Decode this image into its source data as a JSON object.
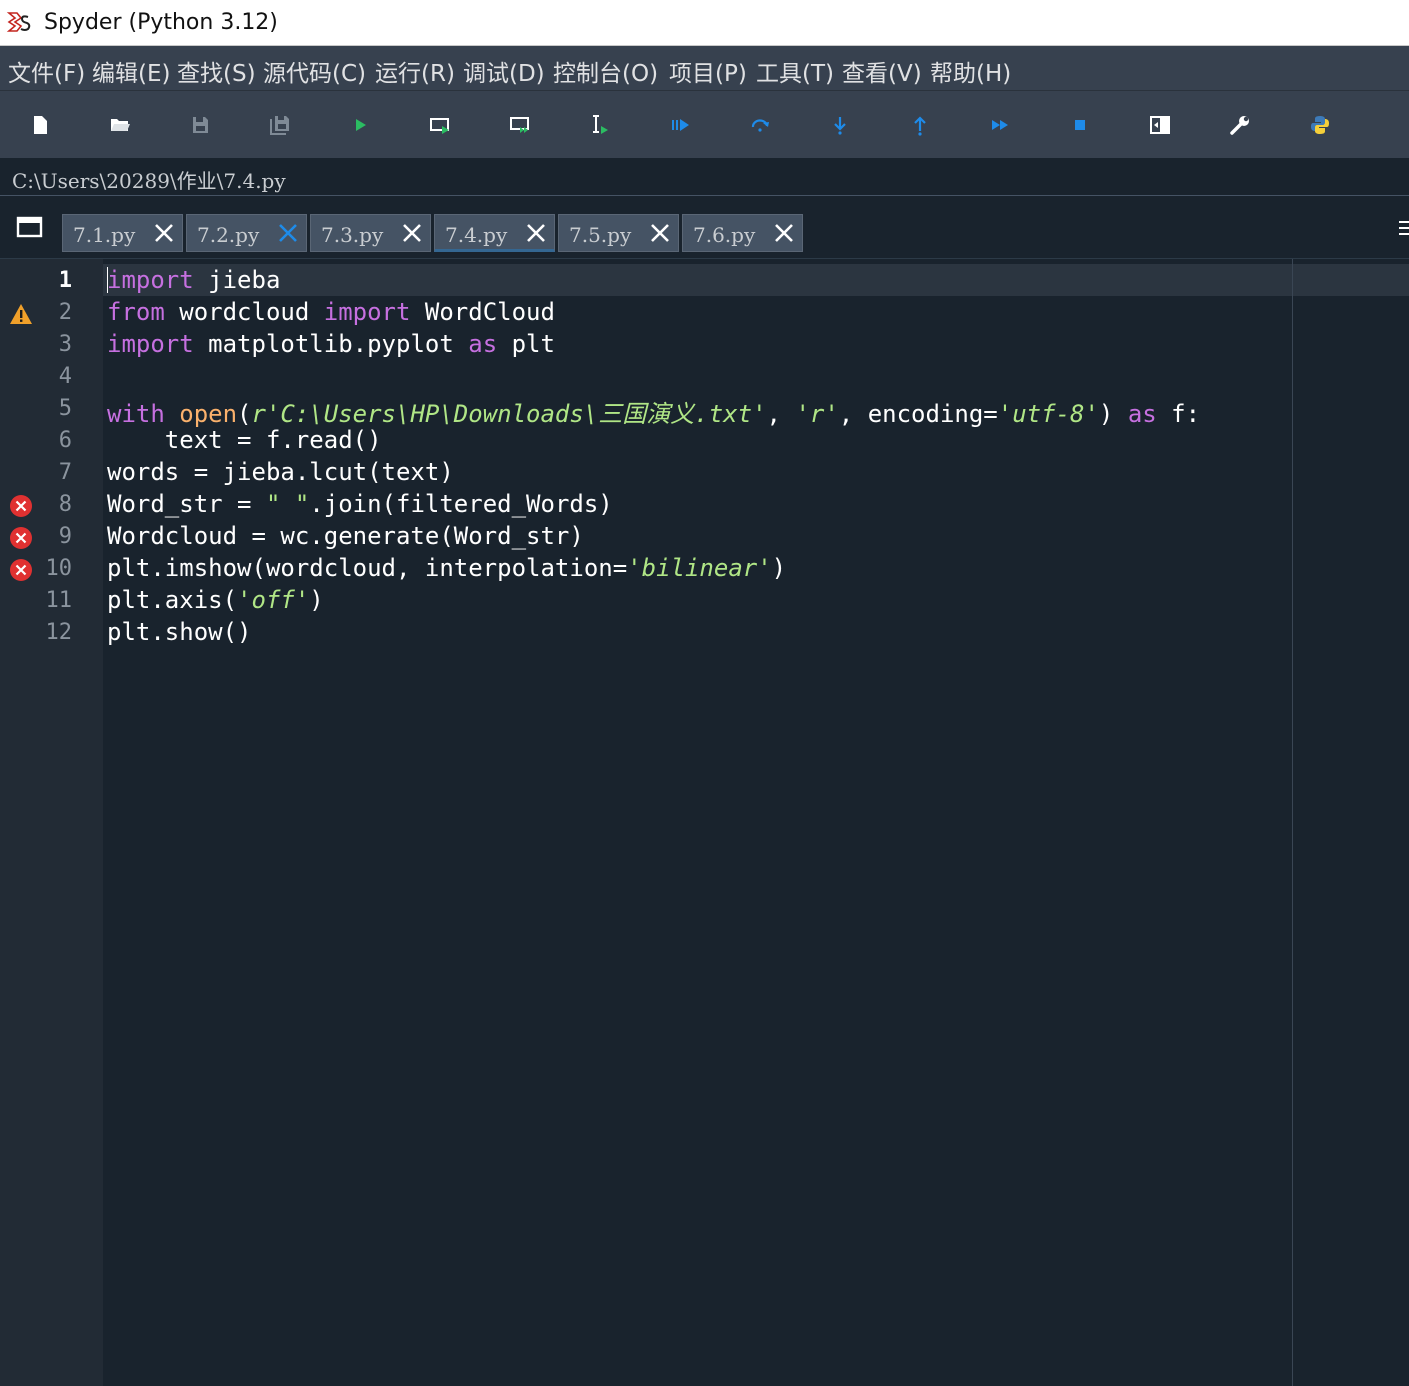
{
  "window": {
    "title": "Spyder (Python 3.12)"
  },
  "menu": [
    "文件(F)",
    "编辑(E)",
    "查找(S)",
    "源代码(C)",
    "运行(R)",
    "调试(D)",
    "控制台(O)",
    "项目(P)",
    "工具(T)",
    "查看(V)",
    "帮助(H)"
  ],
  "toolbar": {
    "icons": [
      "new-file-icon",
      "open-file-icon",
      "save-icon",
      "save-all-icon",
      "run-icon",
      "run-cell-icon",
      "run-cell-advance-icon",
      "run-selection-icon",
      "debug-icon",
      "step-over-icon",
      "step-into-icon",
      "step-return-icon",
      "continue-icon",
      "stop-debug-icon",
      "maximize-pane-icon",
      "preferences-icon",
      "pythonpath-icon"
    ],
    "colors": {
      "accent_green": "#2bbc62",
      "accent_blue": "#1e8be9",
      "dim": "#7f8a96"
    }
  },
  "editor": {
    "path": "C:\\Users\\20289\\作业\\7.4.py",
    "tabs": [
      {
        "label": "7.1.py",
        "active": false
      },
      {
        "label": "7.2.py",
        "active": false
      },
      {
        "label": "7.3.py",
        "active": false
      },
      {
        "label": "7.4.py",
        "active": true
      },
      {
        "label": "7.5.py",
        "active": false
      },
      {
        "label": "7.6.py",
        "active": false
      }
    ],
    "current_line": 1,
    "lines": [
      {
        "no": "1",
        "marker": null,
        "tokens": [
          [
            "kw",
            "import"
          ],
          [
            "",
            " jieba"
          ]
        ]
      },
      {
        "no": "2",
        "marker": "warning",
        "tokens": [
          [
            "kw",
            "from"
          ],
          [
            "",
            " wordcloud "
          ],
          [
            "kw",
            "import"
          ],
          [
            "",
            " WordCloud"
          ]
        ]
      },
      {
        "no": "3",
        "marker": null,
        "tokens": [
          [
            "kw",
            "import"
          ],
          [
            "",
            " matplotlib.pyplot "
          ],
          [
            "kw",
            "as"
          ],
          [
            "",
            " plt"
          ]
        ]
      },
      {
        "no": "4",
        "marker": null,
        "tokens": []
      },
      {
        "no": "5",
        "marker": null,
        "tokens": [
          [
            "kw",
            "with"
          ],
          [
            "",
            " "
          ],
          [
            "bi",
            "open"
          ],
          [
            "",
            "("
          ],
          [
            "str",
            "r'C:\\Users\\HP\\Downloads\\三国演义.txt'"
          ],
          [
            "",
            ", "
          ],
          [
            "str",
            "'r'"
          ],
          [
            "",
            ", encoding="
          ],
          [
            "str",
            "'utf-8'"
          ],
          [
            "",
            ") "
          ],
          [
            "kw",
            "as"
          ],
          [
            "",
            " f:"
          ]
        ]
      },
      {
        "no": "6",
        "marker": null,
        "tokens": [
          [
            "",
            "    text = f.read()"
          ]
        ]
      },
      {
        "no": "7",
        "marker": null,
        "tokens": [
          [
            "",
            "words = jieba.lcut(text)"
          ]
        ]
      },
      {
        "no": "8",
        "marker": "error",
        "tokens": [
          [
            "",
            "Word_str = "
          ],
          [
            "str",
            "\" \""
          ],
          [
            "",
            ".join(filtered_Words)"
          ]
        ]
      },
      {
        "no": "9",
        "marker": "error",
        "tokens": [
          [
            "",
            "Wordcloud = wc.generate(Word_str)"
          ]
        ]
      },
      {
        "no": "10",
        "marker": "error",
        "tokens": [
          [
            "",
            "plt.imshow(wordcloud, interpolation="
          ],
          [
            "str",
            "'bilinear'"
          ],
          [
            "",
            ")"
          ]
        ]
      },
      {
        "no": "11",
        "marker": null,
        "tokens": [
          [
            "",
            "plt.axis("
          ],
          [
            "str",
            "'off'"
          ],
          [
            "",
            ")"
          ]
        ]
      },
      {
        "no": "12",
        "marker": null,
        "tokens": [
          [
            "",
            "plt.show()"
          ]
        ]
      }
    ]
  }
}
